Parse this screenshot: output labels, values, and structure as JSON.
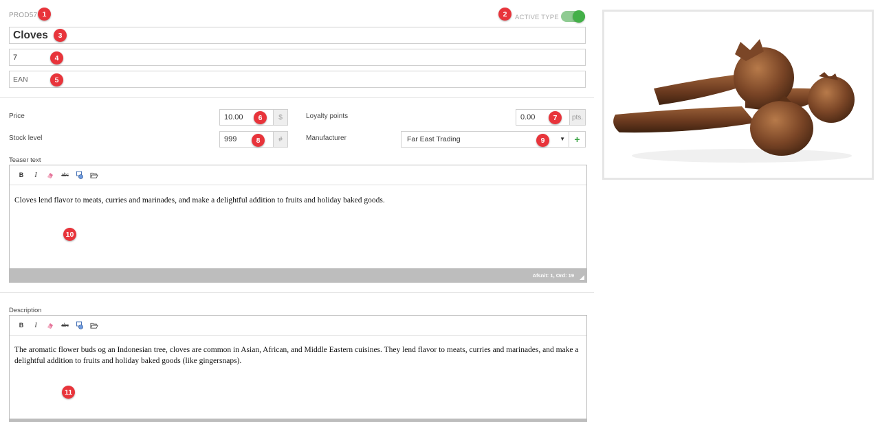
{
  "product": {
    "code": "PROD57",
    "active_label": "ACTIVE TYPE",
    "active": true,
    "name": "Cloves",
    "number": "7",
    "ean_placeholder": "EAN"
  },
  "pricing": {
    "price_label": "Price",
    "price_value": "10.00",
    "price_unit": "$",
    "stock_label": "Stock level",
    "stock_value": "999",
    "stock_unit": "#",
    "loyalty_label": "Loyalty points",
    "loyalty_value": "0.00",
    "loyalty_unit": "pts.",
    "manufacturer_label": "Manufacturer",
    "manufacturer_value": "Far East Trading",
    "add_symbol": "+"
  },
  "teaser": {
    "label": "Teaser text",
    "text": "Cloves lend flavor to meats, curries and marinades, and make a delightful addition to fruits and holiday baked goods.",
    "status": "Afsnit: 1, Ord: 19"
  },
  "description": {
    "label": "Description",
    "text": "The aromatic flower buds og an Indonesian tree, cloves are common in Asian, African, and Middle Eastern cuisines. They lend flavor to meats, curries and marinades, and make a delightful addition to fruits and holiday baked goods (like gingersnaps)."
  },
  "toolbar": {
    "bold": "B",
    "italic": "I",
    "spell": "abc"
  },
  "badges": [
    "1",
    "2",
    "3",
    "4",
    "5",
    "6",
    "7",
    "8",
    "9",
    "10",
    "11"
  ],
  "colors": {
    "badge": "#e8343b",
    "toggle_on": "#43b048",
    "add_button": "#3aa444",
    "statusbar": "#bdbdbd"
  }
}
